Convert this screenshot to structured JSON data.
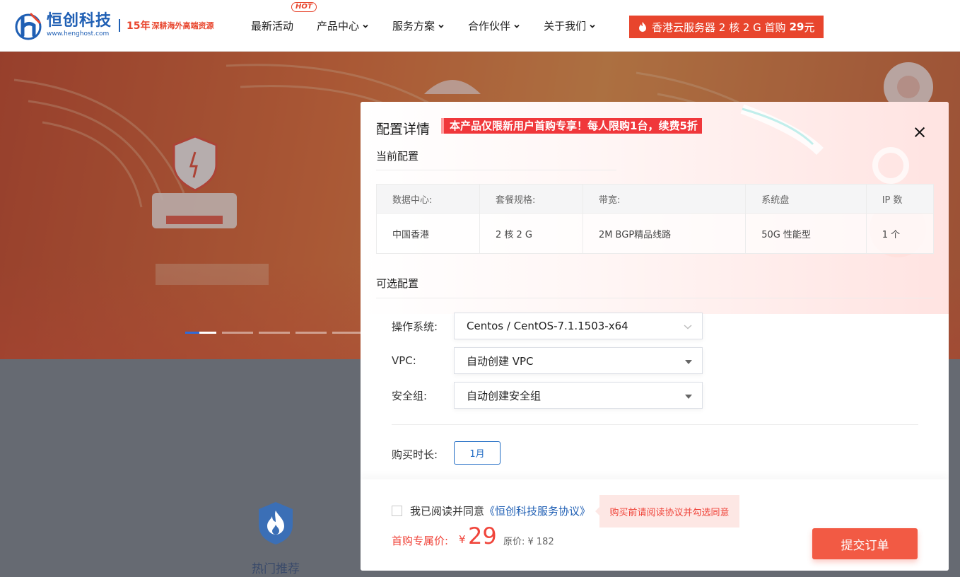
{
  "header": {
    "logo_name": "恒创科技",
    "logo_url": "www.henghost.com",
    "logo_years": "15年",
    "logo_slogan": "深耕海外高端资源",
    "nav": [
      {
        "label": "最新活动",
        "badge": "HOT"
      },
      {
        "label": "产品中心"
      },
      {
        "label": "服务方案"
      },
      {
        "label": "合作伙伴"
      },
      {
        "label": "关于我们"
      }
    ],
    "promo": {
      "text": "香港云服务器 2 核 2 G 首购",
      "price": "29",
      "unit": "元"
    }
  },
  "banner": {
    "slides": 5,
    "active_slide": 0
  },
  "hot_section": {
    "label": "热门推荐",
    "icon": "fire-shield-icon"
  },
  "modal": {
    "title": "配置详情",
    "tag": "本产品仅限新用户首购专享！每人限购1台，续费5折",
    "current_config": {
      "title": "当前配置",
      "headers": [
        "数据中心:",
        "套餐规格:",
        "带宽:",
        "系统盘",
        "IP 数"
      ],
      "values": [
        "中国香港",
        "2 核 2 G",
        "2M BGP精品线路",
        "50G 性能型",
        "1 个"
      ]
    },
    "optional_config": {
      "title": "可选配置",
      "fields": [
        {
          "label": "操作系统:",
          "value": "Centos / CentOS-7.1.1503-x64"
        },
        {
          "label": "VPC:",
          "value": "自动创建 VPC"
        },
        {
          "label": "安全组:",
          "value": "自动创建安全组"
        }
      ]
    },
    "duration": {
      "label": "购买时长:",
      "selected": "1月"
    },
    "agreement": {
      "prefix": "我已阅读并同意",
      "link": "《恒创科技服务协议》",
      "checked": false
    },
    "tooltip": "购买前请阅读协议并勾选同意",
    "price": {
      "label": "首购专属价:",
      "currency": "¥",
      "value": "29",
      "original_label": "原价: ¥ 182"
    },
    "submit_label": "提交订单"
  },
  "colors": {
    "brand_blue": "#1f5fb4",
    "accent_red": "#e8452d",
    "submit": "#f25a44"
  }
}
